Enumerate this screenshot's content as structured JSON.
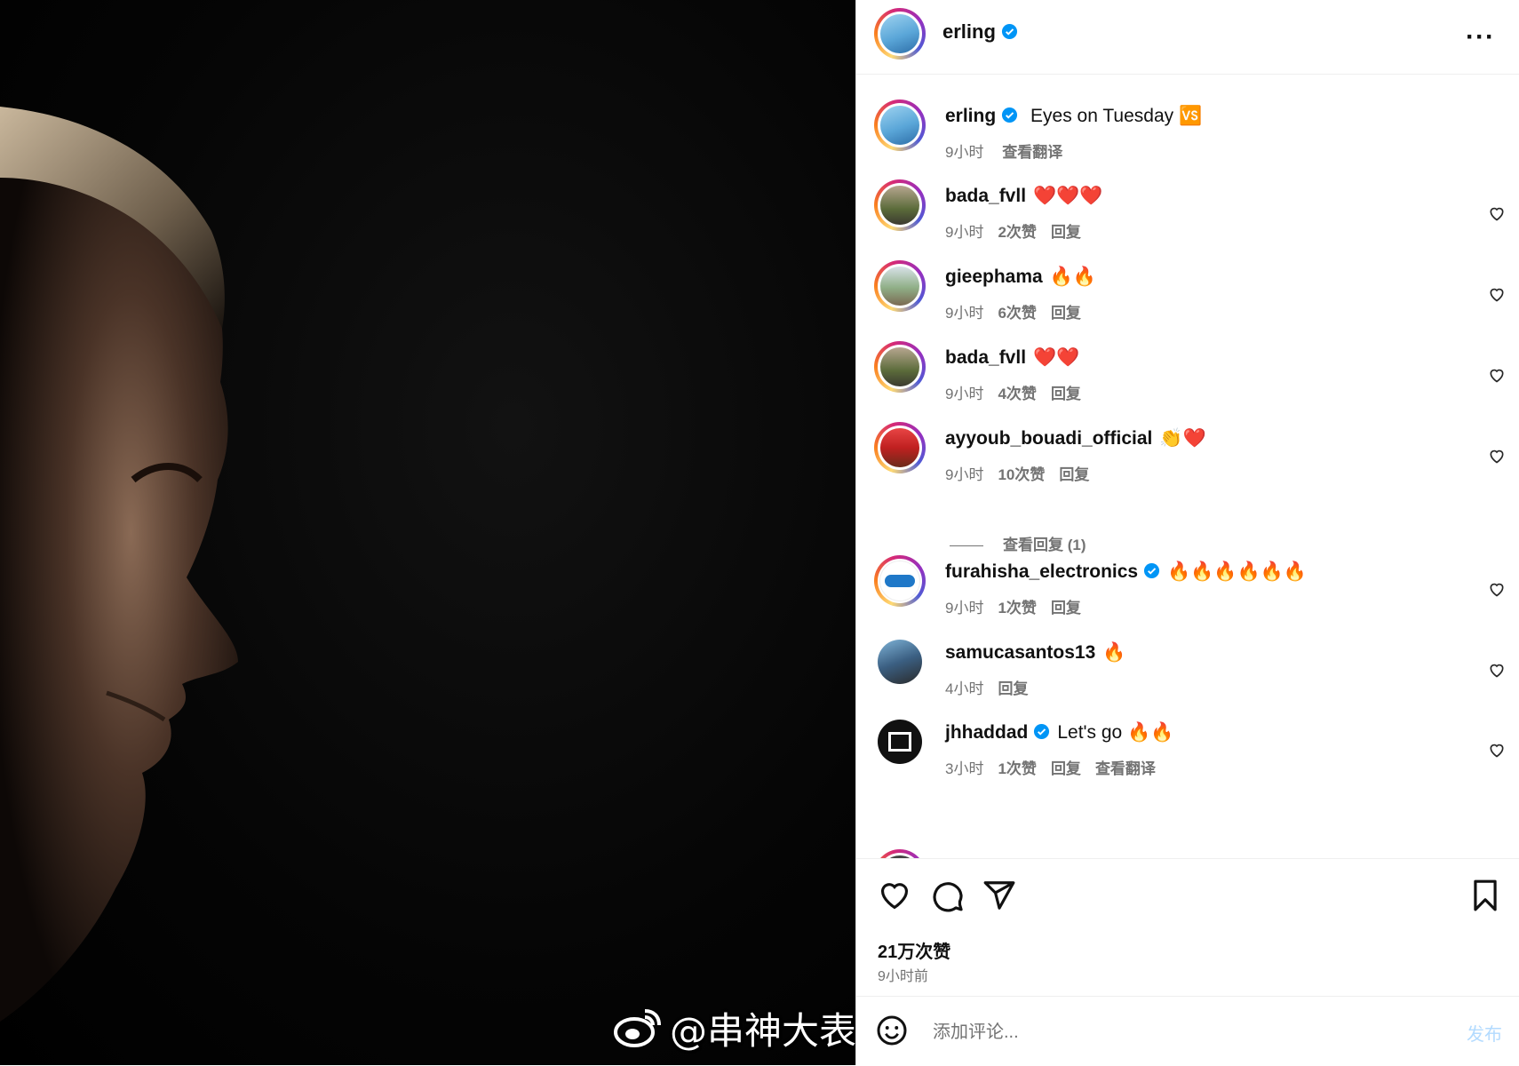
{
  "post": {
    "author": "erling",
    "verified": true,
    "caption": "Eyes on Tuesday",
    "caption_emoji": "🆚",
    "caption_time": "9小时",
    "caption_translate": "查看翻译",
    "more_icon": "more-horizontal-icon",
    "likes": "21万次赞",
    "time_ago": "9小时前"
  },
  "comments": [
    {
      "user": "bada_fvll",
      "verified": false,
      "text": "❤️❤️❤️",
      "time": "9小时",
      "likes": "2次赞",
      "reply": "回复",
      "translate": ""
    },
    {
      "user": "gieephama",
      "verified": false,
      "text": "🔥🔥",
      "time": "9小时",
      "likes": "6次赞",
      "reply": "回复",
      "translate": ""
    },
    {
      "user": "bada_fvll",
      "verified": false,
      "text": "❤️❤️",
      "time": "9小时",
      "likes": "4次赞",
      "reply": "回复",
      "translate": ""
    },
    {
      "user": "ayyoub_bouadi_official",
      "verified": false,
      "text": "👏❤️",
      "time": "9小时",
      "likes": "10次赞",
      "reply": "回复",
      "translate": ""
    },
    {
      "user": "furahisha_electronics",
      "verified": true,
      "text": "🔥🔥🔥🔥🔥🔥",
      "time": "9小时",
      "likes": "1次赞",
      "reply": "回复",
      "translate": ""
    },
    {
      "user": "samucasantos13",
      "verified": false,
      "text": "🔥",
      "time": "4小时",
      "likes": "",
      "reply": "回复",
      "translate": ""
    },
    {
      "user": "jhhaddad",
      "verified": true,
      "text": "Let's go 🔥🔥",
      "time": "3小时",
      "likes": "1次赞",
      "reply": "回复",
      "translate": "查看翻译"
    }
  ],
  "view_replies": "查看回复 (1)",
  "add_comment": {
    "placeholder": "添加评论...",
    "publish": "发布"
  },
  "watermark": "@串神大表哥",
  "colors": {
    "verified": "#0095f6",
    "publish_disabled": "#b3dbff",
    "secondary_text": "#737373"
  }
}
